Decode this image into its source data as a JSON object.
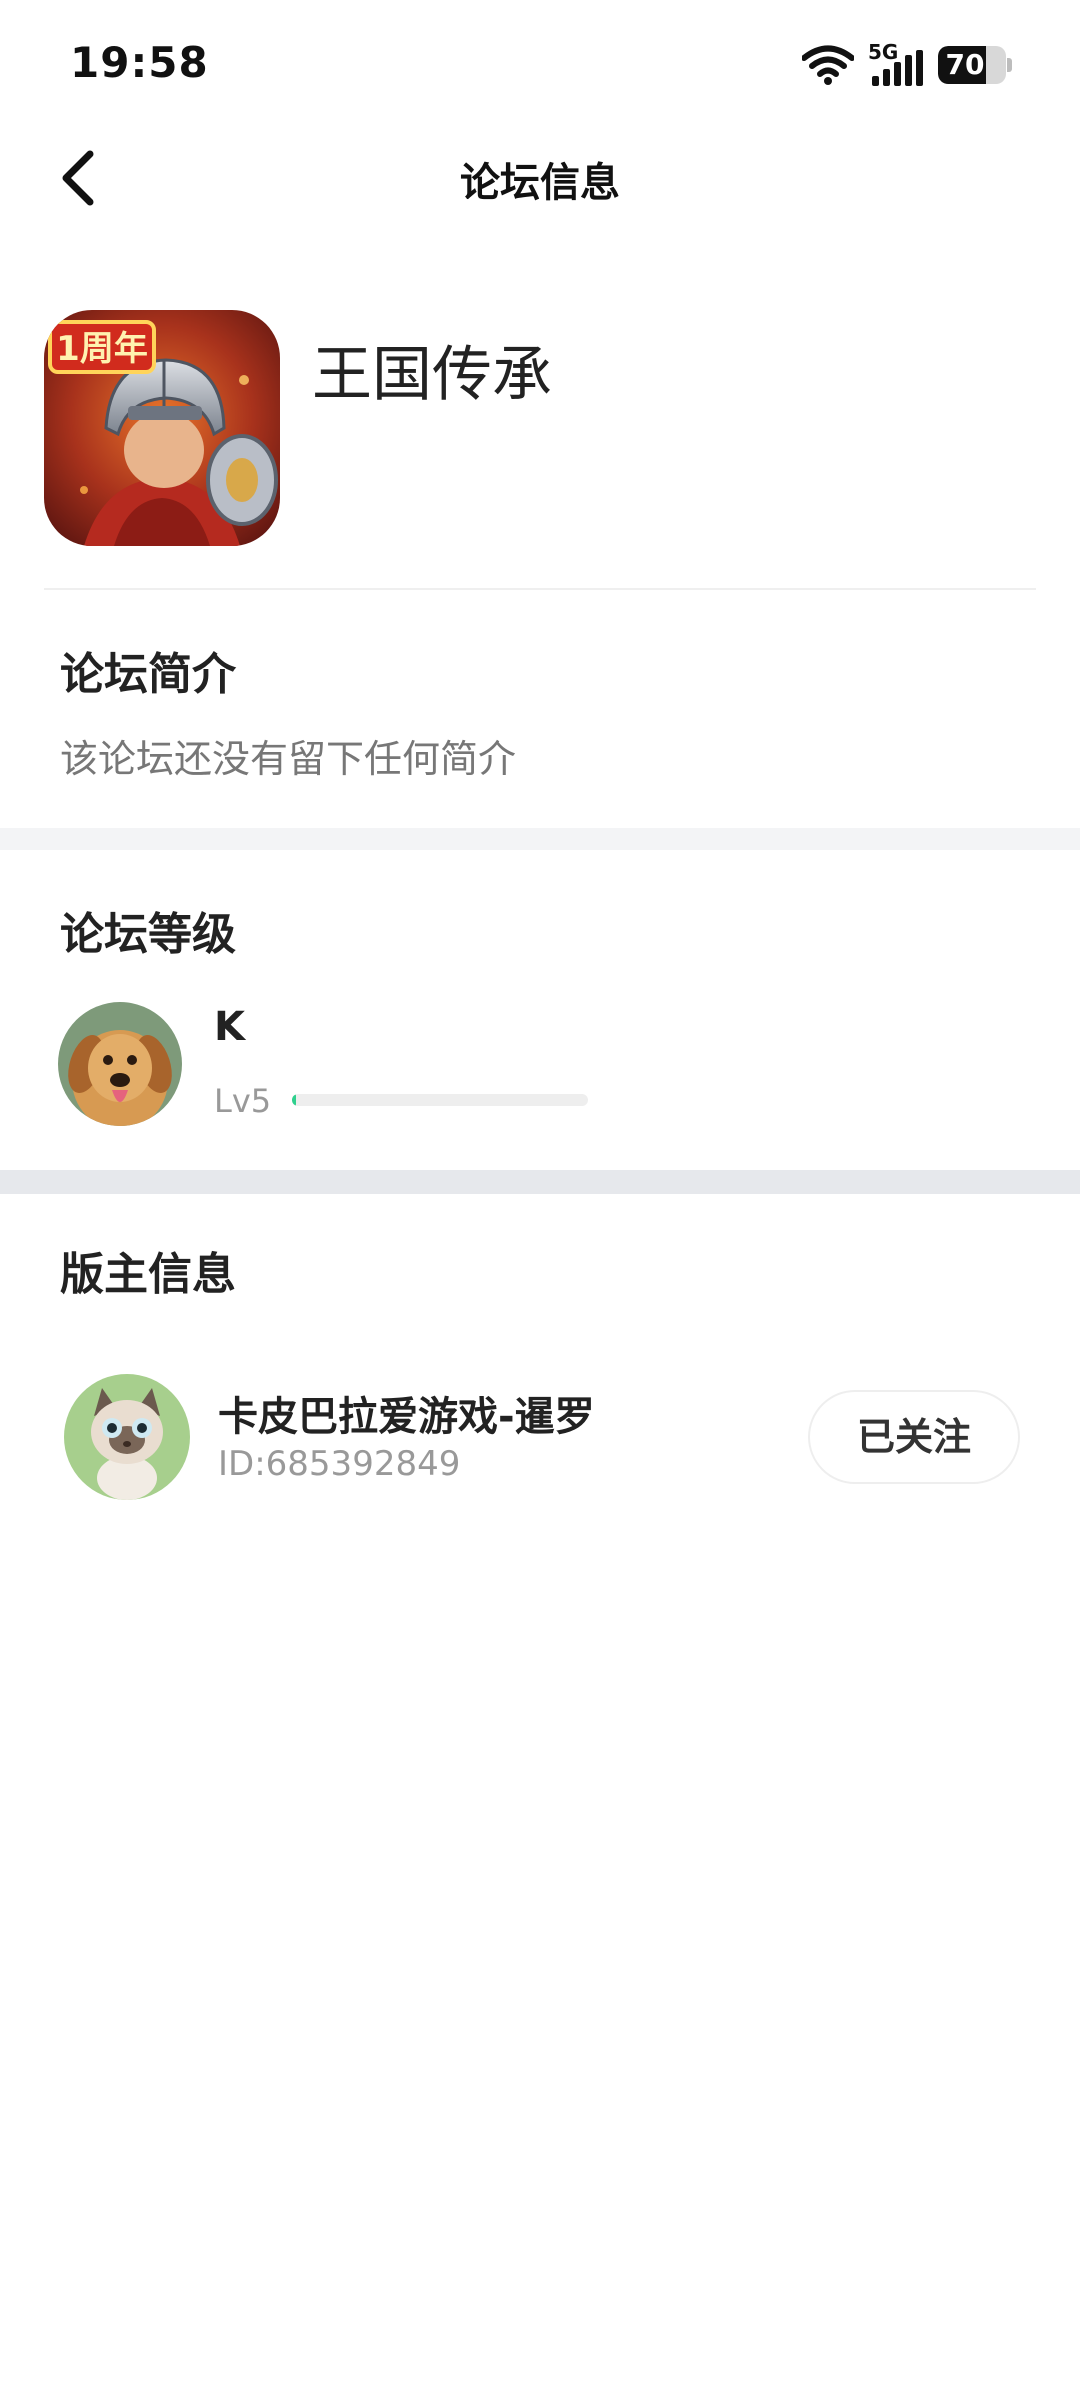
{
  "status_bar": {
    "time": "19:58",
    "network": "5G",
    "battery": "70",
    "battery_level": 0.7,
    "icons": [
      "wifi-icon",
      "signal-icon",
      "battery-icon"
    ]
  },
  "nav": {
    "title": "论坛信息",
    "back_icon": "chevron-left-icon"
  },
  "forum": {
    "name": "王国传承",
    "icon_badge": "1周年"
  },
  "intro": {
    "title": "论坛简介",
    "text": "该论坛还没有留下任何简介"
  },
  "level": {
    "title": "论坛等级",
    "user_name": "K",
    "level_label": "Lv5",
    "progress": 0.01
  },
  "moderator": {
    "title": "版主信息",
    "name": "卡皮巴拉爱游戏-暹罗",
    "id": "ID:685392849",
    "follow_label": "已关注"
  },
  "colors": {
    "accent": "#2fd08e",
    "text_primary": "#222222",
    "text_secondary": "#999999",
    "band": "#f3f4f6"
  }
}
